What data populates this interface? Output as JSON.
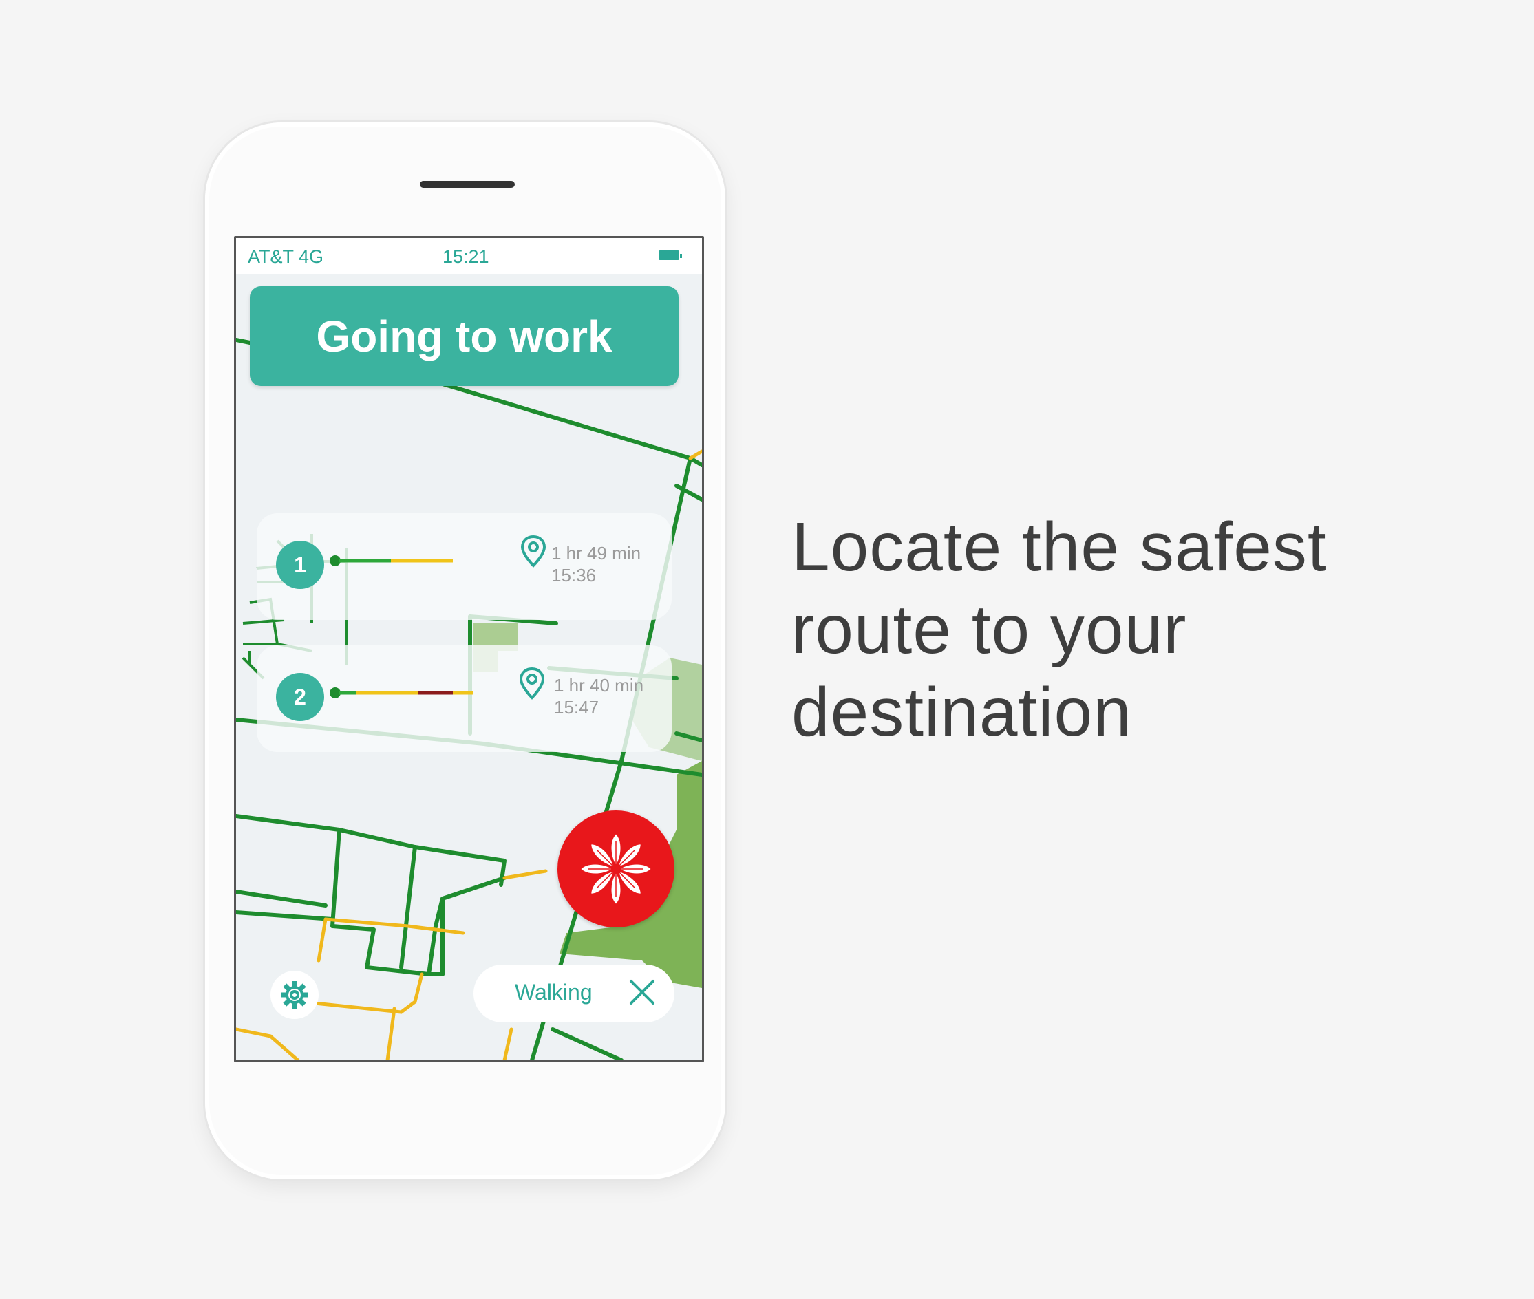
{
  "status_bar": {
    "carrier": "AT&T 4G",
    "time": "15:21",
    "battery_icon": "battery-full-icon"
  },
  "header": {
    "title": "Going to work"
  },
  "routes": [
    {
      "number": "1",
      "duration": "1 hr 49 min",
      "arrival": "15:36",
      "pin_icon": "location-pin-icon"
    },
    {
      "number": "2",
      "duration": "1 hr 40 min",
      "arrival": "15:47",
      "pin_icon": "location-pin-icon"
    }
  ],
  "bottom_bar": {
    "settings_icon": "gear-icon",
    "mode_label": "Walking",
    "close_icon": "close-icon"
  },
  "sos": {
    "icon": "flower-emblem-icon"
  },
  "tagline": {
    "line1": "Locate the safest",
    "line2": "route to your",
    "line3": "destination"
  },
  "colors": {
    "accent": "#3bb39f",
    "road_green": "#1e8c2e",
    "road_yellow": "#f0b81c",
    "route_red": "#8b1c1c",
    "sos_red": "#e8171b"
  }
}
